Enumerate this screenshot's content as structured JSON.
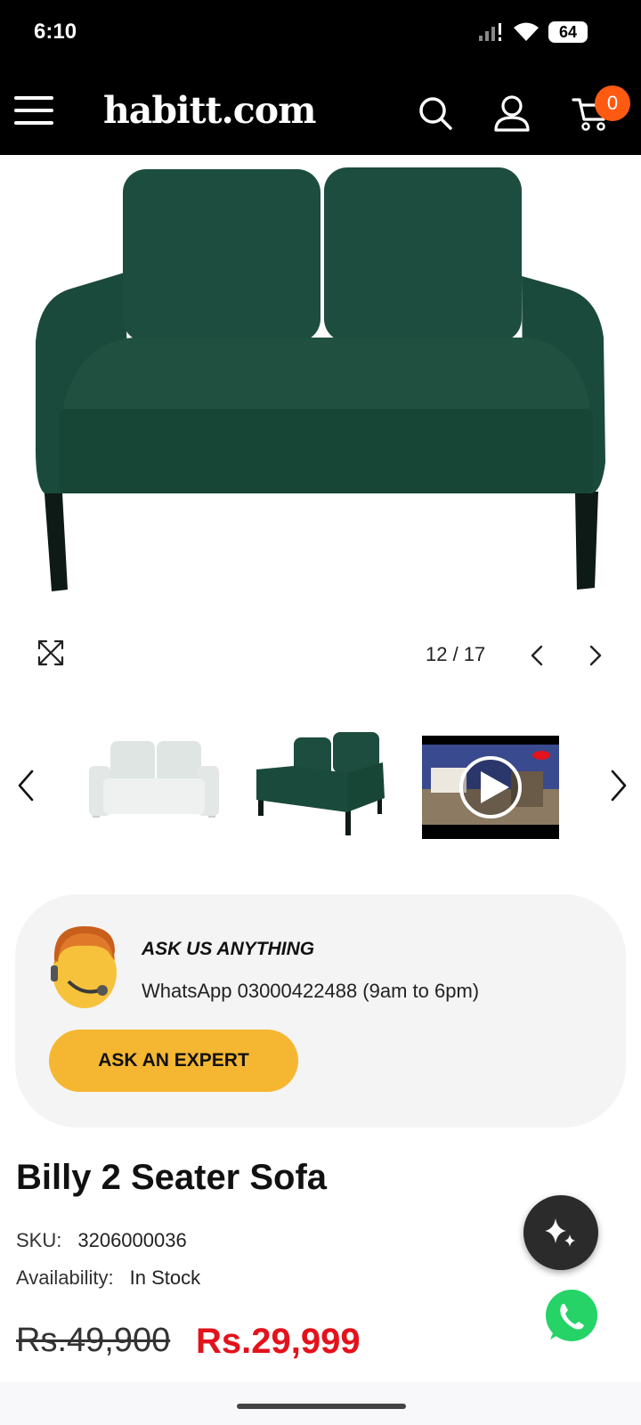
{
  "status_bar": {
    "time": "6:10",
    "battery": "64",
    "icons": [
      "signal-icon",
      "wifi-icon",
      "battery-icon"
    ]
  },
  "header": {
    "logo": "habitt.com",
    "cart_count": "0",
    "icons": [
      "menu-icon",
      "search-icon",
      "user-icon",
      "cart-icon"
    ]
  },
  "gallery": {
    "counter": "12 / 17",
    "thumbnails": [
      "white-sofa-thumbnail",
      "green-sofa-thumbnail",
      "video-thumbnail"
    ]
  },
  "ask_card": {
    "title": "ASK US ANYTHING",
    "whatsapp_text": "WhatsApp 03000422488 (9am to 6pm)",
    "button_label": "ASK AN EXPERT"
  },
  "product": {
    "title": "Billy 2 Seater Sofa",
    "sku_label": "SKU:",
    "sku_value": "3206000036",
    "availability_label": "Availability:",
    "availability_value": "In Stock",
    "price_old": "Rs.49,900",
    "price_new": "Rs.29,999"
  },
  "colors": {
    "header_bg": "#000000",
    "cart_badge": "#ff5a12",
    "ask_button": "#f5b731",
    "price_new": "#e3121b",
    "sofa_green": "#184a3b",
    "whatsapp_green": "#25d366"
  }
}
